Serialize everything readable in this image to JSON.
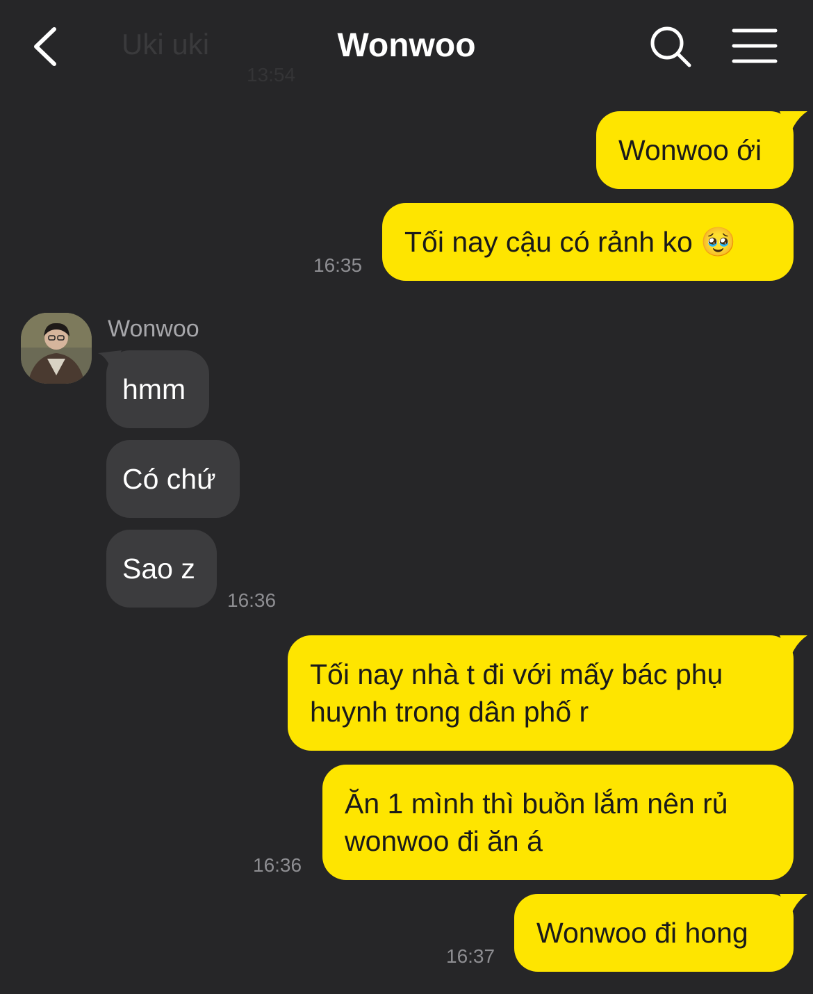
{
  "header": {
    "title": "Wonwoo",
    "ghost_title": "Uki uki",
    "ghost_time": "13:54",
    "icons": {
      "back": "chevron-left-icon",
      "search": "search-icon",
      "menu": "hamburger-menu-icon"
    }
  },
  "colors": {
    "background": "#262628",
    "outgoing_bubble": "#fee500",
    "incoming_bubble": "#3c3c3e",
    "timestamp": "#8e8e92"
  },
  "messages": [
    {
      "direction": "outgoing",
      "text": "Wonwoo ới"
    },
    {
      "direction": "outgoing",
      "text": "Tối nay cậu có rảnh ko 🥹",
      "time": "16:35"
    },
    {
      "direction": "incoming",
      "sender": "Wonwoo",
      "text": "hmm"
    },
    {
      "direction": "incoming",
      "text": "Có chứ"
    },
    {
      "direction": "incoming",
      "text": "Sao z",
      "time": "16:36"
    },
    {
      "direction": "outgoing",
      "text": "Tối nay nhà t đi với mấy bác phụ huynh trong dân phố r"
    },
    {
      "direction": "outgoing",
      "text": "Ăn 1 mình thì buồn lắm nên rủ wonwoo đi ăn á",
      "time": "16:36"
    },
    {
      "direction": "outgoing",
      "text": "Wonwoo đi hong",
      "time": "16:37"
    }
  ]
}
